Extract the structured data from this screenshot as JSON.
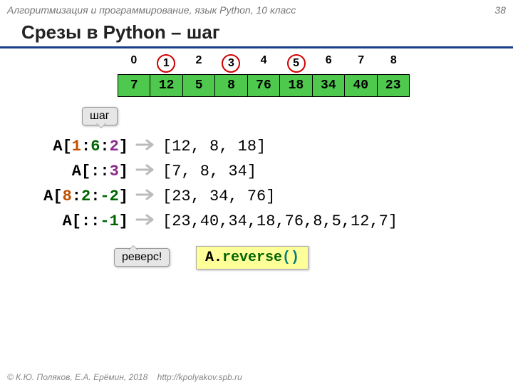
{
  "header": {
    "course": "Алгоритмизация и программирование, язык Python, 10 класс",
    "pageno": "38"
  },
  "title": "Срезы в Python – шаг",
  "indices": [
    "0",
    "1",
    "2",
    "3",
    "4",
    "5",
    "6",
    "7",
    "8"
  ],
  "circled": [
    1,
    3,
    5
  ],
  "array": [
    "7",
    "12",
    "5",
    "8",
    "76",
    "18",
    "34",
    "40",
    "23"
  ],
  "callouts": {
    "step": "шаг",
    "reverse": "реверс!"
  },
  "lines": [
    {
      "pre": "A[",
      "a": "1",
      "b": ":",
      "c": "6",
      "d": ":",
      "e": "2",
      "post": "]",
      "result": "[12, 8, 18]",
      "cls": [
        "n1",
        "",
        "n2",
        "",
        "n3"
      ]
    },
    {
      "pre": "A[",
      "a": "",
      "b": ":",
      "c": "",
      "d": ":",
      "e": "3",
      "post": "]",
      "result": "[7, 8, 34]",
      "cls": [
        "",
        "",
        "",
        "",
        "n3"
      ]
    },
    {
      "pre": "A[",
      "a": "8",
      "b": ":",
      "c": "2",
      "d": ":",
      "e": "-2",
      "post": "]",
      "result": "[23, 34, 76]",
      "cls": [
        "n1",
        "",
        "n2",
        "",
        "n4"
      ]
    },
    {
      "pre": "A[",
      "a": "",
      "b": ":",
      "c": "",
      "d": ":",
      "e": "-1",
      "post": "]",
      "result": "[23,40,34,18,76,8,5,12,7]",
      "cls": [
        "",
        "",
        "",
        "",
        "n4"
      ]
    }
  ],
  "reverse_expr": {
    "obj": "A.",
    "method": "reverse",
    "paren": "()"
  },
  "footer": {
    "copy": "© К.Ю. Поляков, Е.А. Ерёмин, 2018",
    "url": "http://kpolyakov.spb.ru"
  }
}
